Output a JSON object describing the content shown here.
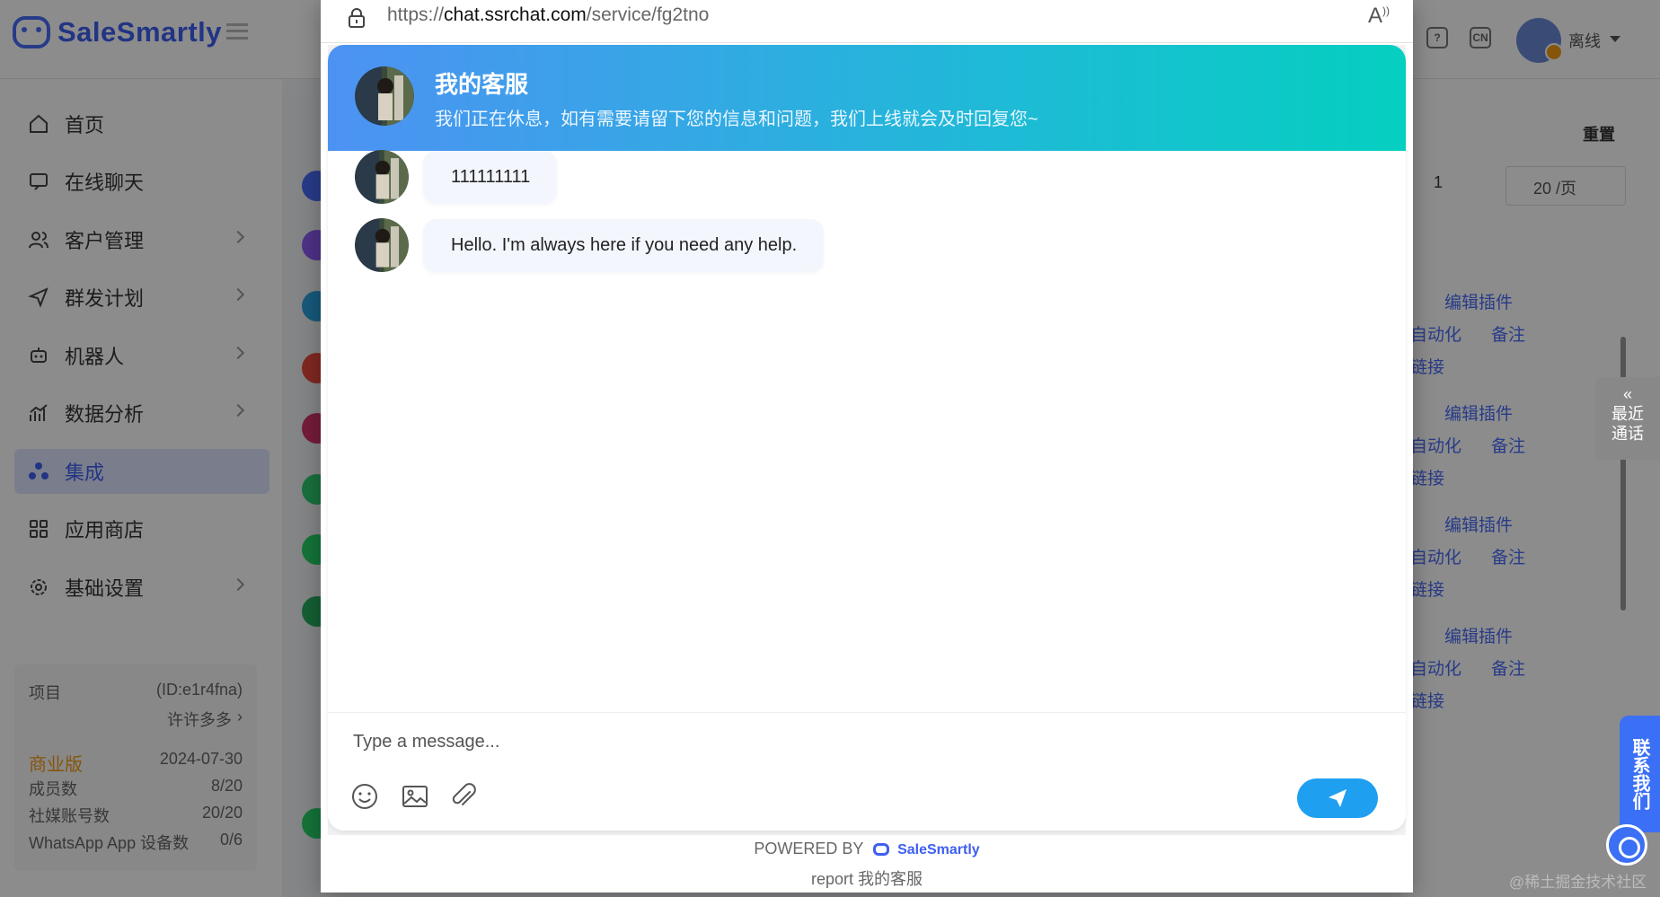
{
  "app": {
    "brand": "SaleSmartly",
    "status": "离线"
  },
  "sidebar": {
    "items": [
      {
        "label": "首页"
      },
      {
        "label": "在线聊天"
      },
      {
        "label": "客户管理"
      },
      {
        "label": "群发计划"
      },
      {
        "label": "机器人"
      },
      {
        "label": "数据分析"
      },
      {
        "label": "集成"
      },
      {
        "label": "应用商店"
      },
      {
        "label": "基础设置"
      }
    ],
    "project": {
      "label": "项目",
      "id": "(ID:e1r4fna)",
      "name": "许许多多",
      "plan": "商业版",
      "plan_date": "2024-07-30",
      "members_label": "成员数",
      "members_value": "8/20",
      "social_label": "社媒账号数",
      "social_value": "20/20",
      "whatsapp_label": "WhatsApp App 设备数",
      "whatsapp_value": "0/6"
    }
  },
  "background": {
    "reset_label": "重置",
    "page_number": "1",
    "page_size": "20 /页",
    "actions": {
      "edit_plugin": "编辑插件",
      "automation": "自动化",
      "note": "备注",
      "link": "链接"
    },
    "recent_tab": "最近通话",
    "contact_tab": "联系我们",
    "watermark": "@稀土掘金技术社区"
  },
  "browser": {
    "url_prefix": "https://",
    "url_host": "chat.ssrchat.com",
    "url_path": "/service/fg2tno"
  },
  "chat": {
    "header_title": "我的客服",
    "header_subtitle": "我们正在休息，如有需要请留下您的信息和问题，我们上线就会及时回复您~",
    "messages": [
      {
        "text": "111111111"
      },
      {
        "text": "Hello. I'm always here if you need any help."
      }
    ],
    "input_placeholder": "Type a message...",
    "powered_by": "POWERED BY",
    "powered_brand": "SaleSmartly",
    "report": "report 我的客服"
  },
  "colors": {
    "accent": "#3f5ff0",
    "header_gradient_start": "#4d92f3",
    "header_gradient_end": "#05cfc0",
    "send_button": "#1e9ff0"
  }
}
